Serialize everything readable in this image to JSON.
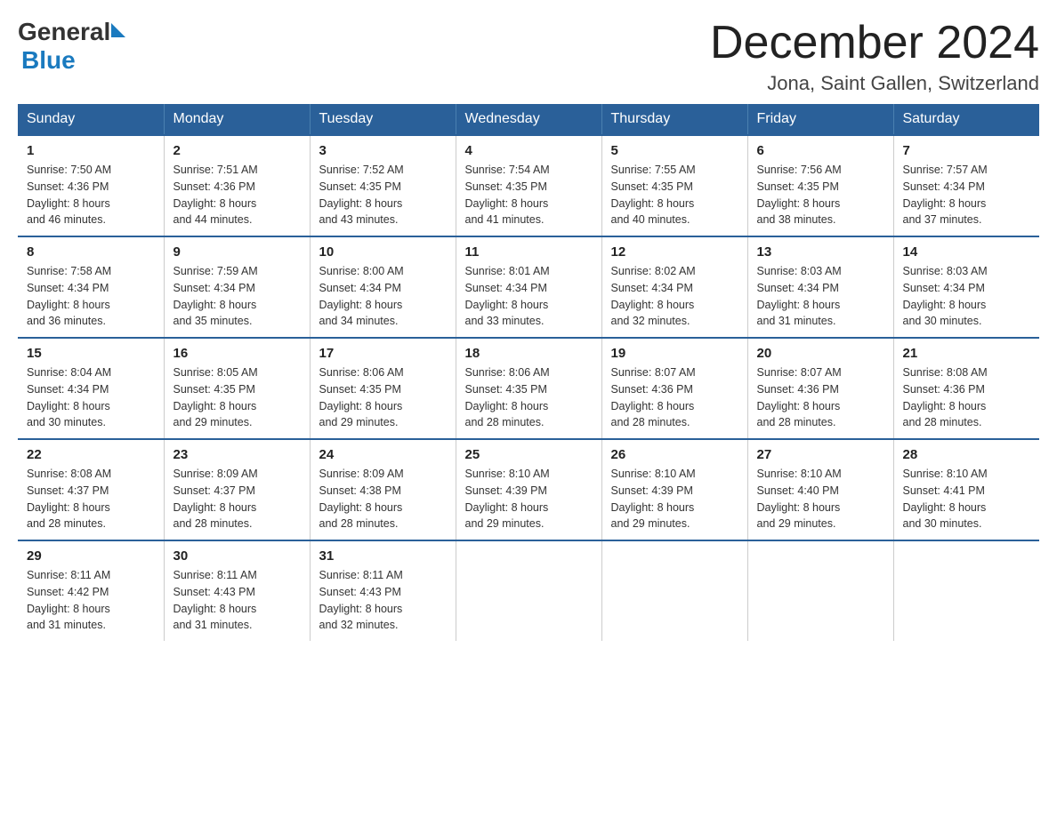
{
  "logo": {
    "text_general": "General",
    "text_blue": "Blue"
  },
  "title": {
    "month_year": "December 2024",
    "location": "Jona, Saint Gallen, Switzerland"
  },
  "days_of_week": [
    "Sunday",
    "Monday",
    "Tuesday",
    "Wednesday",
    "Thursday",
    "Friday",
    "Saturday"
  ],
  "weeks": [
    [
      {
        "day": "1",
        "sunrise": "7:50 AM",
        "sunset": "4:36 PM",
        "daylight": "8 hours and 46 minutes."
      },
      {
        "day": "2",
        "sunrise": "7:51 AM",
        "sunset": "4:36 PM",
        "daylight": "8 hours and 44 minutes."
      },
      {
        "day": "3",
        "sunrise": "7:52 AM",
        "sunset": "4:35 PM",
        "daylight": "8 hours and 43 minutes."
      },
      {
        "day": "4",
        "sunrise": "7:54 AM",
        "sunset": "4:35 PM",
        "daylight": "8 hours and 41 minutes."
      },
      {
        "day": "5",
        "sunrise": "7:55 AM",
        "sunset": "4:35 PM",
        "daylight": "8 hours and 40 minutes."
      },
      {
        "day": "6",
        "sunrise": "7:56 AM",
        "sunset": "4:35 PM",
        "daylight": "8 hours and 38 minutes."
      },
      {
        "day": "7",
        "sunrise": "7:57 AM",
        "sunset": "4:34 PM",
        "daylight": "8 hours and 37 minutes."
      }
    ],
    [
      {
        "day": "8",
        "sunrise": "7:58 AM",
        "sunset": "4:34 PM",
        "daylight": "8 hours and 36 minutes."
      },
      {
        "day": "9",
        "sunrise": "7:59 AM",
        "sunset": "4:34 PM",
        "daylight": "8 hours and 35 minutes."
      },
      {
        "day": "10",
        "sunrise": "8:00 AM",
        "sunset": "4:34 PM",
        "daylight": "8 hours and 34 minutes."
      },
      {
        "day": "11",
        "sunrise": "8:01 AM",
        "sunset": "4:34 PM",
        "daylight": "8 hours and 33 minutes."
      },
      {
        "day": "12",
        "sunrise": "8:02 AM",
        "sunset": "4:34 PM",
        "daylight": "8 hours and 32 minutes."
      },
      {
        "day": "13",
        "sunrise": "8:03 AM",
        "sunset": "4:34 PM",
        "daylight": "8 hours and 31 minutes."
      },
      {
        "day": "14",
        "sunrise": "8:03 AM",
        "sunset": "4:34 PM",
        "daylight": "8 hours and 30 minutes."
      }
    ],
    [
      {
        "day": "15",
        "sunrise": "8:04 AM",
        "sunset": "4:34 PM",
        "daylight": "8 hours and 30 minutes."
      },
      {
        "day": "16",
        "sunrise": "8:05 AM",
        "sunset": "4:35 PM",
        "daylight": "8 hours and 29 minutes."
      },
      {
        "day": "17",
        "sunrise": "8:06 AM",
        "sunset": "4:35 PM",
        "daylight": "8 hours and 29 minutes."
      },
      {
        "day": "18",
        "sunrise": "8:06 AM",
        "sunset": "4:35 PM",
        "daylight": "8 hours and 28 minutes."
      },
      {
        "day": "19",
        "sunrise": "8:07 AM",
        "sunset": "4:36 PM",
        "daylight": "8 hours and 28 minutes."
      },
      {
        "day": "20",
        "sunrise": "8:07 AM",
        "sunset": "4:36 PM",
        "daylight": "8 hours and 28 minutes."
      },
      {
        "day": "21",
        "sunrise": "8:08 AM",
        "sunset": "4:36 PM",
        "daylight": "8 hours and 28 minutes."
      }
    ],
    [
      {
        "day": "22",
        "sunrise": "8:08 AM",
        "sunset": "4:37 PM",
        "daylight": "8 hours and 28 minutes."
      },
      {
        "day": "23",
        "sunrise": "8:09 AM",
        "sunset": "4:37 PM",
        "daylight": "8 hours and 28 minutes."
      },
      {
        "day": "24",
        "sunrise": "8:09 AM",
        "sunset": "4:38 PM",
        "daylight": "8 hours and 28 minutes."
      },
      {
        "day": "25",
        "sunrise": "8:10 AM",
        "sunset": "4:39 PM",
        "daylight": "8 hours and 29 minutes."
      },
      {
        "day": "26",
        "sunrise": "8:10 AM",
        "sunset": "4:39 PM",
        "daylight": "8 hours and 29 minutes."
      },
      {
        "day": "27",
        "sunrise": "8:10 AM",
        "sunset": "4:40 PM",
        "daylight": "8 hours and 29 minutes."
      },
      {
        "day": "28",
        "sunrise": "8:10 AM",
        "sunset": "4:41 PM",
        "daylight": "8 hours and 30 minutes."
      }
    ],
    [
      {
        "day": "29",
        "sunrise": "8:11 AM",
        "sunset": "4:42 PM",
        "daylight": "8 hours and 31 minutes."
      },
      {
        "day": "30",
        "sunrise": "8:11 AM",
        "sunset": "4:43 PM",
        "daylight": "8 hours and 31 minutes."
      },
      {
        "day": "31",
        "sunrise": "8:11 AM",
        "sunset": "4:43 PM",
        "daylight": "8 hours and 32 minutes."
      },
      null,
      null,
      null,
      null
    ]
  ],
  "labels": {
    "sunrise": "Sunrise:",
    "sunset": "Sunset:",
    "daylight": "Daylight:"
  }
}
